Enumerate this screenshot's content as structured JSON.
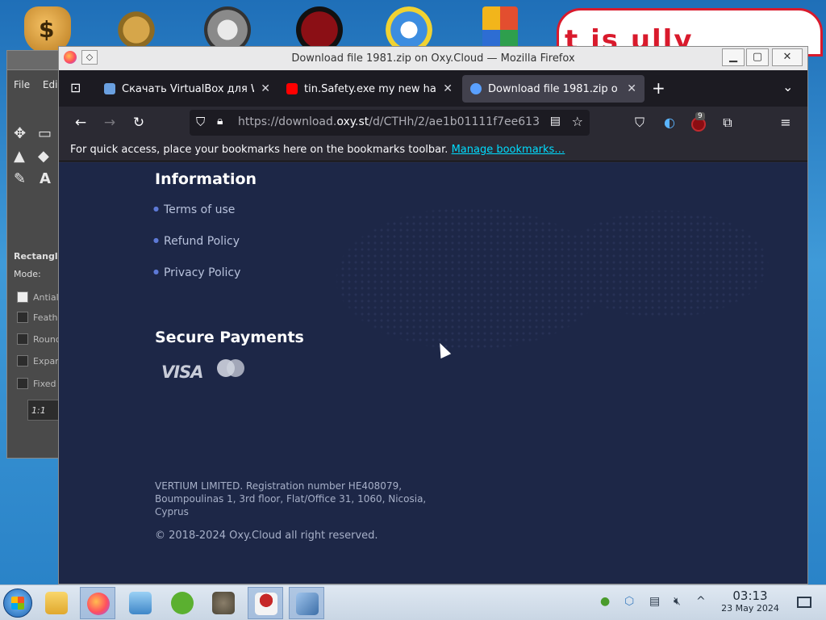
{
  "desktop": {
    "promo_text": "t  is  ully"
  },
  "gimp": {
    "menu_file": "File",
    "menu_edit": "Edi",
    "tool_options_title": "Rectangle",
    "mode_label": "Mode:",
    "options": [
      "Antial",
      "Feath",
      "Round",
      "Expan",
      "Fixed"
    ],
    "ratio": "1:1"
  },
  "window": {
    "title": "Download file 1981.zip on Oxy.Cloud — Mozilla Firefox",
    "minimize": "▁",
    "maximize": "▢",
    "close": "✕"
  },
  "tabs": [
    {
      "label": "Скачать VirtualBox для W",
      "color": "#6aa0e0"
    },
    {
      "label": "tin.Safety.exe my new ha",
      "color": "#ff0000"
    },
    {
      "label": "Download file 1981.zip o",
      "color": "#5aa0ff"
    }
  ],
  "toolbar": {
    "url_prefix": "https://download.",
    "url_domain": "oxy.st",
    "url_rest": "/d/CTHh/2/ae1b01111f7ee613",
    "ublock_count": "9"
  },
  "bookmarks_bar": {
    "text": "For quick access, place your bookmarks here on the bookmarks toolbar.",
    "link": "Manage bookmarks…"
  },
  "page": {
    "information_title": "Information",
    "links": [
      "Terms of use",
      "Refund Policy",
      "Privacy Policy"
    ],
    "payments_title": "Secure Payments",
    "visa": "VISA",
    "legal": "VERTIUM LIMITED. Registration number HE408079, Boumpoulinas 1, 3rd floor, Flat/Office 31, 1060, Nicosia, Cyprus",
    "copyright": "© 2018-2024  Oxy.Cloud all right reserved."
  },
  "taskbar": {
    "time": "03:13",
    "date": "23 May 2024"
  },
  "colors": {
    "page_bg": "#1d2747",
    "link_color": "#00ddff"
  }
}
